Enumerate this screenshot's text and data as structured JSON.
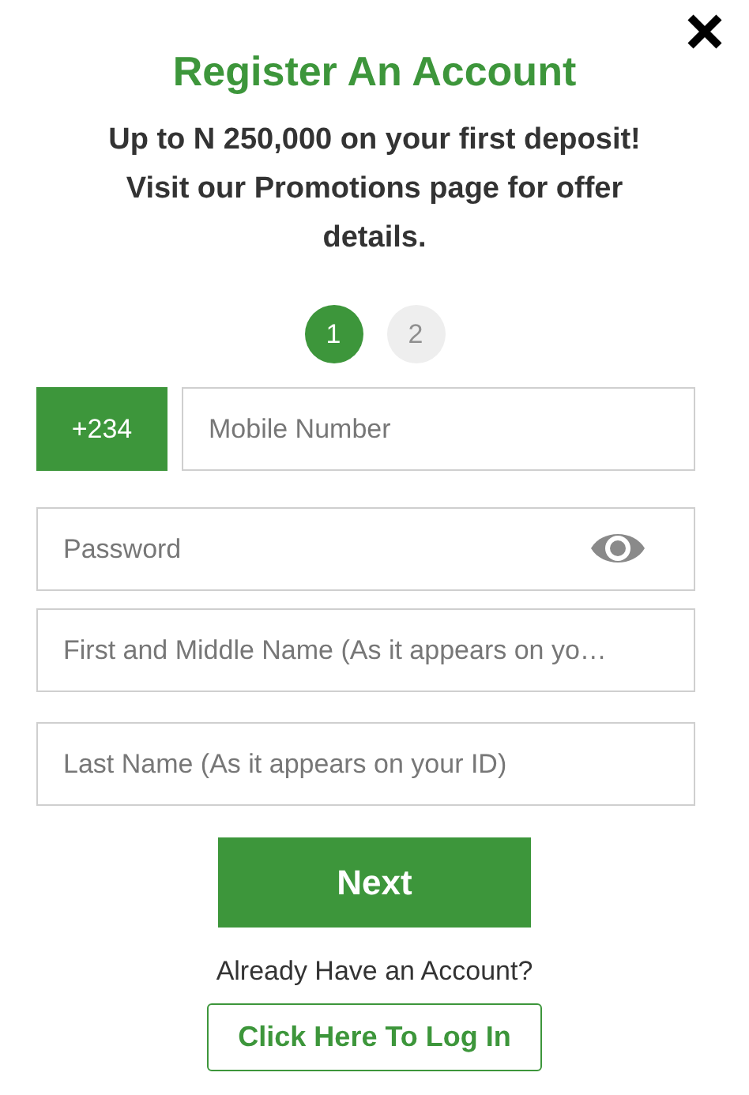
{
  "title": "Register An Account",
  "promo": "Up to N 250,000 on your first deposit! Visit our Promotions page for offer details.",
  "steps": [
    {
      "label": "1",
      "selected": true
    },
    {
      "label": "2",
      "selected": false
    }
  ],
  "fields": [
    {
      "kind": "phone",
      "prefix": "+234",
      "placeholder": "Mobile Number"
    },
    {
      "kind": "password",
      "placeholder": "Password"
    },
    {
      "kind": "text",
      "placeholder": "First and Middle Name (As it appears on yo…"
    },
    {
      "kind": "text",
      "placeholder": "Last Name (As it appears on your ID)"
    }
  ],
  "next_button": "Next",
  "login_prompt": "Already Have an Account?",
  "login_button": "Click Here To Log In"
}
